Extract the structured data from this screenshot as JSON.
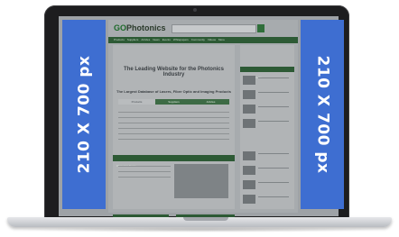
{
  "ads": {
    "left_text": "210 X 700 px",
    "right_text": "210 X 700 px",
    "color": "#3e6ed1"
  },
  "site": {
    "logo_prefix": "GO",
    "logo_suffix": "Photonics",
    "nav": [
      "Products",
      "Suppliers",
      "Articles",
      "News",
      "Events",
      "Whitepapers",
      "Community",
      "Videos",
      "More"
    ],
    "headline": "The Leading Website for the Photonics Industry",
    "database_title": "The Largest Database of Lasers, Fiber Optic and Imaging Products",
    "tabs": [
      "Products",
      "Suppliers",
      "Articles"
    ],
    "news_label": "Photonics News",
    "sidebar_label": "Latest Products"
  }
}
